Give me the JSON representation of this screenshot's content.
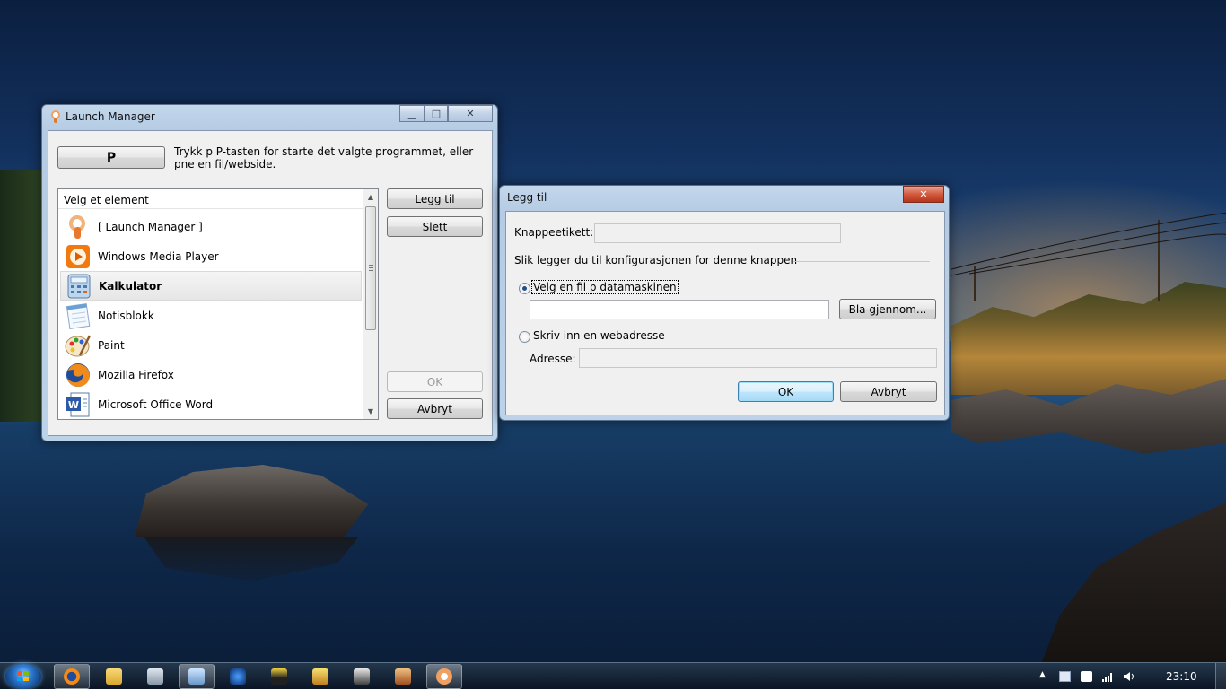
{
  "launch_manager": {
    "title": "Launch Manager",
    "key_button": "P",
    "instruction": "Trykk p P-tasten for  starte det valgte programmet, eller pne en fil/webside.",
    "list_header": "Velg et element",
    "items": [
      {
        "label": "[ Launch Manager ]",
        "icon": "launch-manager-icon"
      },
      {
        "label": "Windows Media Player",
        "icon": "media-player-icon"
      },
      {
        "label": "Kalkulator",
        "icon": "calculator-icon",
        "selected": true
      },
      {
        "label": "Notisblokk",
        "icon": "notepad-icon"
      },
      {
        "label": "Paint",
        "icon": "paint-icon"
      },
      {
        "label": "Mozilla Firefox",
        "icon": "firefox-icon"
      },
      {
        "label": "Microsoft Office Word",
        "icon": "word-icon"
      }
    ],
    "buttons": {
      "add": "Legg til",
      "delete": "Slett",
      "ok": "OK",
      "cancel": "Avbryt"
    }
  },
  "add_dialog": {
    "title": "Legg til",
    "button_label_caption": "Knappeetikett:",
    "button_label_value": "",
    "section_caption": "Slik legger du til konfigurasjonen for denne knappen",
    "option_file": "Velg en fil p datamaskinen",
    "file_path_value": "",
    "browse_button": "Bla gjennom...",
    "option_web": "Skriv inn en webadresse",
    "address_caption": "Adresse:",
    "address_value": "",
    "ok_button": "OK",
    "cancel_button": "Avbryt"
  },
  "taskbar": {
    "pinned": [
      "firefox-icon",
      "explorer-icon",
      "device-icon",
      "launch-manager-task-icon",
      "app-icon",
      "tb-icon",
      "civ-icon",
      "cs-icon",
      "game-icon",
      "launch-manager-running-icon"
    ],
    "clock": "23:10"
  }
}
